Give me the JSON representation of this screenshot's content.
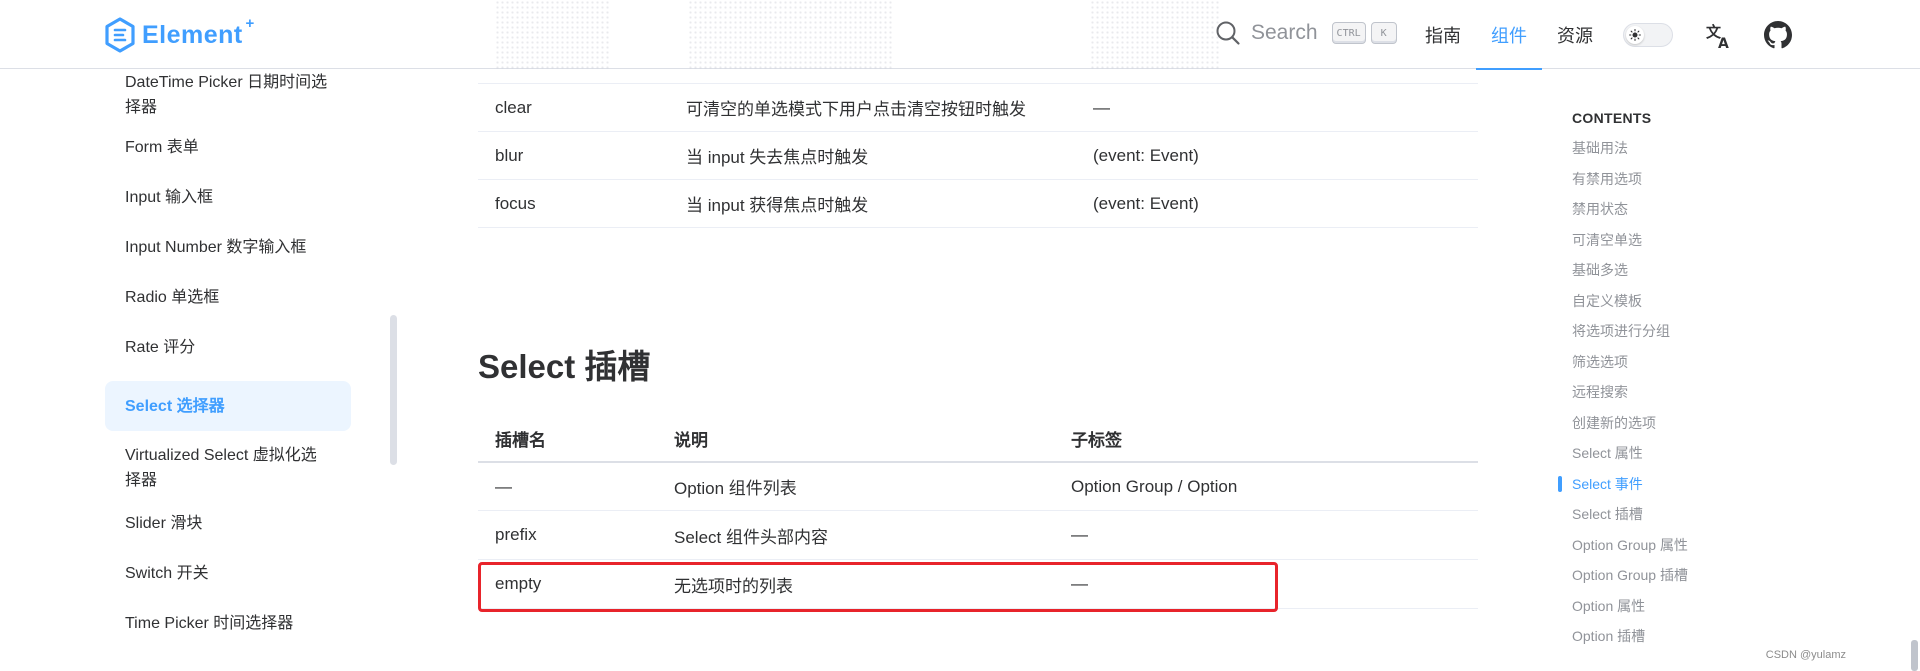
{
  "header": {
    "logo_text": "Element",
    "logo_plus": "+",
    "search_label": "Search",
    "kbd_ctrl": "CTRL",
    "kbd_k": "K",
    "nav": [
      {
        "label": "指南"
      },
      {
        "label": "组件"
      },
      {
        "label": "资源"
      }
    ],
    "active_nav": "组件"
  },
  "sidebar": {
    "items": [
      {
        "label": "DateTime Picker 日期时间选择器"
      },
      {
        "label": "Form 表单"
      },
      {
        "label": "Input 输入框"
      },
      {
        "label": "Input Number 数字输入框"
      },
      {
        "label": "Radio 单选框"
      },
      {
        "label": "Rate 评分"
      },
      {
        "label": "Select 选择器"
      },
      {
        "label": "Virtualized Select 虚拟化选择器"
      },
      {
        "label": "Slider 滑块"
      },
      {
        "label": "Switch 开关"
      },
      {
        "label": "Time Picker 时间选择器"
      }
    ],
    "active_item": "Select 选择器"
  },
  "events_table": {
    "rows": [
      {
        "name": "clear",
        "desc": "可清空的单选模式下用户点击清空按钮时触发",
        "params": "—"
      },
      {
        "name": "blur",
        "desc": "当 input 失去焦点时触发",
        "params": "(event: Event)"
      },
      {
        "name": "focus",
        "desc": "当 input 获得焦点时触发",
        "params": "(event: Event)"
      }
    ]
  },
  "slots_section": {
    "title": "Select 插槽",
    "columns": [
      "插槽名",
      "说明",
      "子标签"
    ],
    "rows": [
      {
        "name": "—",
        "desc": "Option 组件列表",
        "sub": "Option Group / Option"
      },
      {
        "name": "prefix",
        "desc": "Select 组件头部内容",
        "sub": "—"
      },
      {
        "name": "empty",
        "desc": "无选项时的列表",
        "sub": "—"
      }
    ],
    "highlighted_row": "empty",
    "highlight_color": "#e8242b"
  },
  "toc": {
    "title": "CONTENTS",
    "items": [
      {
        "label": "基础用法"
      },
      {
        "label": "有禁用选项"
      },
      {
        "label": "禁用状态"
      },
      {
        "label": "可清空单选"
      },
      {
        "label": "基础多选"
      },
      {
        "label": "自定义模板"
      },
      {
        "label": "将选项进行分组"
      },
      {
        "label": "筛选选项"
      },
      {
        "label": "远程搜索"
      },
      {
        "label": "创建新的选项"
      },
      {
        "label": "Select 属性"
      },
      {
        "label": "Select 事件"
      },
      {
        "label": "Select 插槽"
      },
      {
        "label": "Option Group 属性"
      },
      {
        "label": "Option Group 插槽"
      },
      {
        "label": "Option 属性"
      },
      {
        "label": "Option 插槽"
      }
    ],
    "active_item": "Select 事件"
  },
  "watermark": "CSDN @yulamz",
  "colors": {
    "brand": "#409eff",
    "active_bg": "#ecf5ff",
    "text": "#303133",
    "muted": "#909399"
  }
}
